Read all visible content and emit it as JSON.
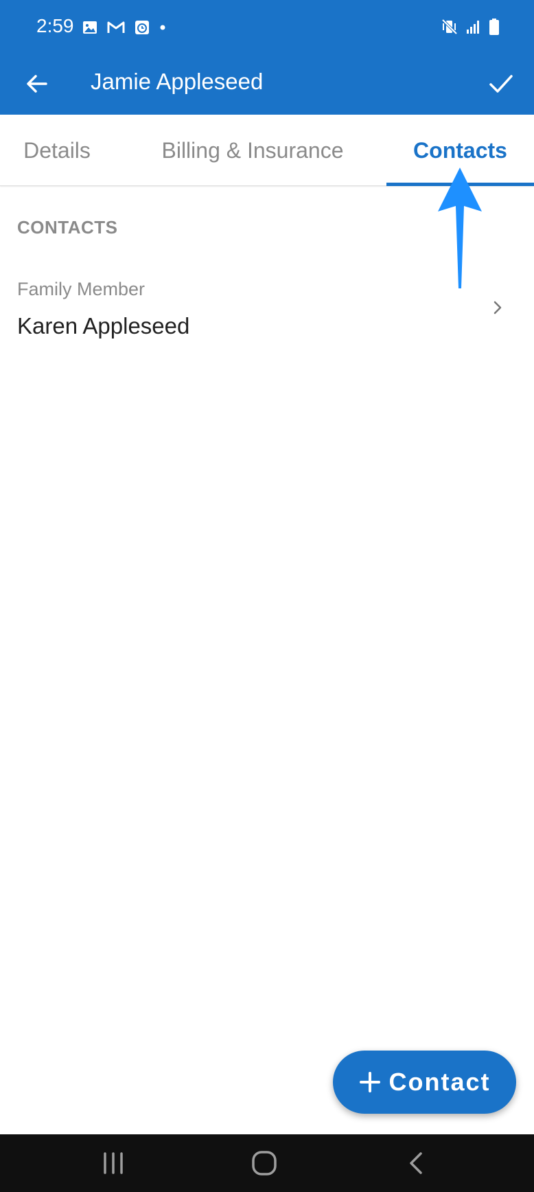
{
  "status_bar": {
    "time": "2:59",
    "left_icons": [
      "image-icon",
      "gmail-icon",
      "clock-app-icon",
      "dot-icon"
    ],
    "right_icons": [
      "vibrate-mute-icon",
      "signal-icon",
      "battery-icon"
    ]
  },
  "app_bar": {
    "title": "Jamie Appleseed",
    "back_icon": "arrow-left-icon",
    "done_icon": "check-icon",
    "background": "#1a73c8"
  },
  "tabs": [
    {
      "label": "Details",
      "active": false
    },
    {
      "label": "Billing & Insurance",
      "active": false
    },
    {
      "label": "Contacts",
      "active": true
    }
  ],
  "contacts_section": {
    "header": "CONTACTS",
    "items": [
      {
        "relation": "Family Member",
        "name": "Karen Appleseed",
        "icon": "chevron-right-icon"
      }
    ]
  },
  "fab": {
    "icon": "plus-icon",
    "label": "Contact"
  },
  "nav_bar": {
    "icons": [
      "recents-icon",
      "home-icon",
      "back-icon"
    ]
  },
  "colors": {
    "primary": "#1a73c8",
    "annotation_arrow": "#1e90ff",
    "inactive_text": "#8a8a8a",
    "primary_text": "#212121",
    "nav_bar": "#101010"
  }
}
